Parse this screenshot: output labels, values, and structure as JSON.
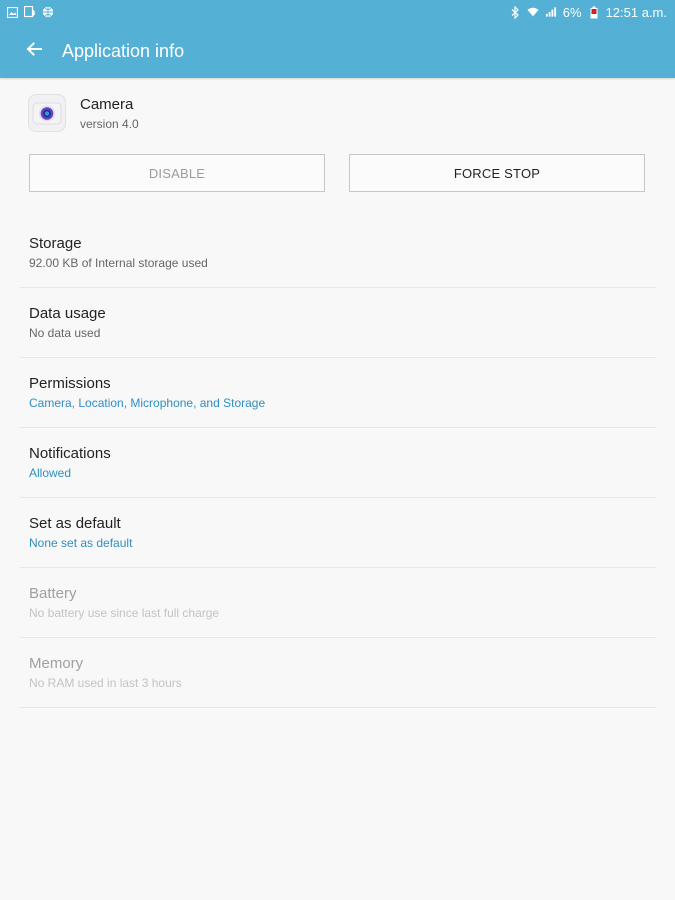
{
  "status_bar": {
    "battery_percent": "6%",
    "time": "12:51 a.m.",
    "left_icons": [
      "image-icon",
      "download-icon",
      "globe-icon"
    ],
    "right_icons": [
      "bluetooth-icon",
      "wifi-icon",
      "signal-icon",
      "battery-icon"
    ]
  },
  "app_bar": {
    "title": "Application info"
  },
  "app": {
    "name": "Camera",
    "version": "version 4.0"
  },
  "buttons": {
    "disable": "DISABLE",
    "force_stop": "FORCE STOP"
  },
  "settings": [
    {
      "title": "Storage",
      "subtitle": "92.00 KB of Internal storage used"
    },
    {
      "title": "Data usage",
      "subtitle": "No data used"
    },
    {
      "title": "Permissions",
      "subtitle": "Camera, Location, Microphone, and Storage"
    },
    {
      "title": "Notifications",
      "subtitle": "Allowed"
    },
    {
      "title": "Set as default",
      "subtitle": "None set as default"
    },
    {
      "title": "Battery",
      "subtitle": "No battery use since last full charge"
    },
    {
      "title": "Memory",
      "subtitle": "No RAM used in last 3 hours"
    }
  ],
  "colors": {
    "accent": "#55b0d6",
    "link": "#2f8fc4",
    "background": "#f8f8f8"
  }
}
